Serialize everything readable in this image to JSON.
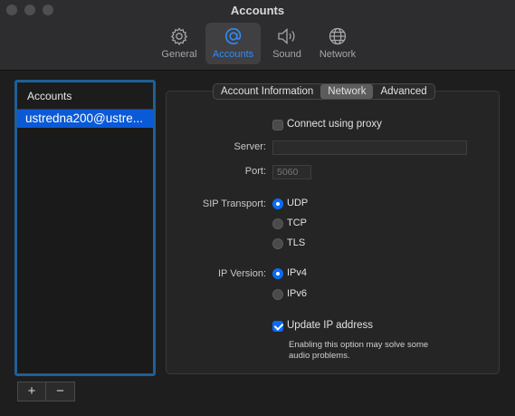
{
  "window": {
    "title": "Accounts"
  },
  "toolbar": {
    "items": [
      {
        "label": "General",
        "icon": "gear-icon",
        "active": false
      },
      {
        "label": "Accounts",
        "icon": "at-sign-icon",
        "active": true
      },
      {
        "label": "Sound",
        "icon": "speaker-icon",
        "active": false
      },
      {
        "label": "Network",
        "icon": "globe-icon",
        "active": false
      }
    ],
    "active_color": "#2f8df7"
  },
  "accounts_list": {
    "header": "Accounts",
    "items": [
      "ustredna200@ustre..."
    ],
    "selected_color": "#0a59d6",
    "add_label": "+",
    "remove_label": "−"
  },
  "tabs": {
    "items": [
      "Account Information",
      "Network",
      "Advanced"
    ],
    "selected": "Network"
  },
  "network": {
    "proxy": {
      "label": "Connect using proxy",
      "checked": false
    },
    "server": {
      "label": "Server:",
      "value": ""
    },
    "port": {
      "label": "Port:",
      "placeholder": "5060"
    },
    "sip_transport": {
      "label": "SIP Transport:",
      "options": [
        "UDP",
        "TCP",
        "TLS"
      ],
      "selected": "UDP"
    },
    "ip_version": {
      "label": "IP Version:",
      "options": [
        "IPv4",
        "IPv6"
      ],
      "selected": "IPv4"
    },
    "update_ip": {
      "label": "Update IP address",
      "checked": true
    },
    "hint_line1": "Enabling this option may solve some",
    "hint_line2": "audio problems."
  }
}
